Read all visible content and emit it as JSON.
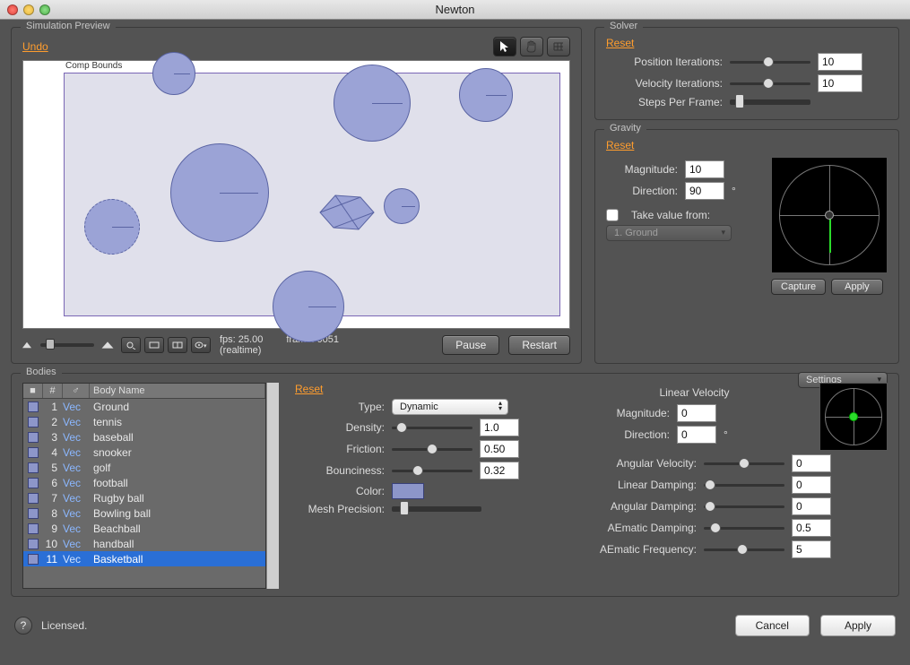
{
  "window": {
    "title": "Newton"
  },
  "preview": {
    "legend": "Simulation Preview",
    "undo": "Undo",
    "compBounds": "Comp Bounds",
    "fps": "fps: 25.00",
    "realtime": "(realtime)",
    "frame": "frame:  0051",
    "pause": "Pause",
    "restart": "Restart"
  },
  "solver": {
    "legend": "Solver",
    "reset": "Reset",
    "posIterLabel": "Position Iterations:",
    "posIter": "10",
    "velIterLabel": "Velocity Iterations:",
    "velIter": "10",
    "stepsLabel": "Steps Per Frame:"
  },
  "gravity": {
    "legend": "Gravity",
    "reset": "Reset",
    "magnitudeLabel": "Magnitude:",
    "magnitude": "10",
    "directionLabel": "Direction:",
    "direction": "90",
    "deg": "°",
    "takeFrom": "Take value from:",
    "takeFromValue": "1. Ground",
    "capture": "Capture",
    "apply": "Apply"
  },
  "bodies": {
    "legend": "Bodies",
    "reset": "Reset",
    "settings": "Settings",
    "headers": {
      "num": "#",
      "type": "♂",
      "name": "Body Name"
    },
    "items": [
      {
        "n": "1",
        "t": "Vec",
        "name": "Ground"
      },
      {
        "n": "2",
        "t": "Vec",
        "name": "tennis"
      },
      {
        "n": "3",
        "t": "Vec",
        "name": "baseball"
      },
      {
        "n": "4",
        "t": "Vec",
        "name": "snooker"
      },
      {
        "n": "5",
        "t": "Vec",
        "name": "golf"
      },
      {
        "n": "6",
        "t": "Vec",
        "name": "football"
      },
      {
        "n": "7",
        "t": "Vec",
        "name": "Rugby ball"
      },
      {
        "n": "8",
        "t": "Vec",
        "name": "Bowling ball"
      },
      {
        "n": "9",
        "t": "Vec",
        "name": "Beachball"
      },
      {
        "n": "10",
        "t": "Vec",
        "name": "handball"
      },
      {
        "n": "11",
        "t": "Vec",
        "name": "Basketball"
      }
    ],
    "props": {
      "typeLabel": "Type:",
      "type": "Dynamic",
      "densityLabel": "Density:",
      "density": "1.0",
      "frictionLabel": "Friction:",
      "friction": "0.50",
      "bouncinessLabel": "Bounciness:",
      "bounciness": "0.32",
      "colorLabel": "Color:",
      "meshLabel": "Mesh Precision:",
      "linVelHeader": "Linear Velocity",
      "linMagLabel": "Magnitude:",
      "linMag": "0",
      "linDirLabel": "Direction:",
      "linDir": "0",
      "deg": "°",
      "angVelLabel": "Angular Velocity:",
      "angVel": "0",
      "linDampLabel": "Linear Damping:",
      "linDamp": "0",
      "angDampLabel": "Angular Damping:",
      "angDamp": "0",
      "aeDampLabel": "AEmatic Damping:",
      "aeDamp": "0.5",
      "aeFreqLabel": "AEmatic Frequency:",
      "aeFreq": "5"
    }
  },
  "footer": {
    "licensed": "Licensed.",
    "cancel": "Cancel",
    "apply": "Apply"
  }
}
